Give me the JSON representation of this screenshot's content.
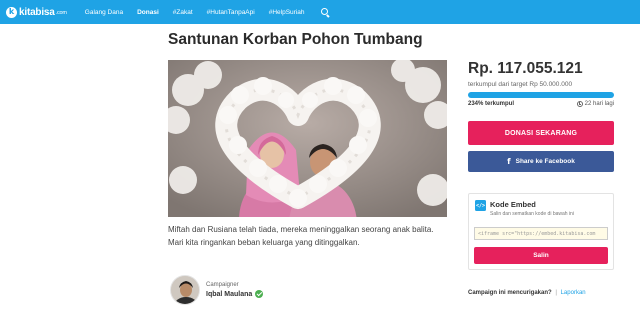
{
  "navbar": {
    "brand_mark": "k",
    "brand_name": "kitabisa",
    "brand_domain": ".com",
    "links": [
      {
        "label": "Galang Dana"
      },
      {
        "label": "Donasi"
      },
      {
        "label": "#Zakat"
      },
      {
        "label": "#HutanTanpaApi"
      },
      {
        "label": "#HelpSuriah"
      }
    ],
    "search_icon": "search-icon",
    "accent_color": "#1fa3e5"
  },
  "campaign": {
    "title": "Santunan Korban Pohon Tumbang",
    "description": "Miftah dan Rusiana telah tiada, mereka meninggalkan seorang anak balita. Mari kita ringankan beban keluarga yang ditinggalkan.",
    "campaigner_label": "Campaigner",
    "campaigner_name": "Iqbal Maulana"
  },
  "funding": {
    "amount": "Rp. 117.055.121",
    "target": "terkumpul dari target Rp 50.000.000",
    "progress_fraction": 1.0,
    "percent_text": "234% terkumpul",
    "days_text": "22 hari lagi"
  },
  "actions": {
    "donate_label": "DONASI SEKARANG",
    "share_icon": "f",
    "share_label": "Share ke Facebook",
    "donate_color": "#e6215c",
    "facebook_color": "#3b5998"
  },
  "embed": {
    "icon_glyph": "</>",
    "title": "Kode Embed",
    "subtitle": "Salin dan sematkan kode di bawah ini",
    "code": "<iframe src=\"https://embed.kitabisa.com",
    "copy_label": "Salin"
  },
  "report": {
    "question": "Campaign ini mencurigakan?",
    "separator": "|",
    "link": "Laporkan"
  }
}
